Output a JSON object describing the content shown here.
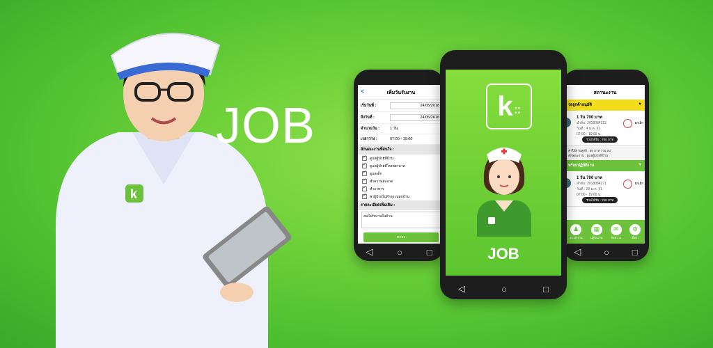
{
  "headline": "JOB",
  "center_app": {
    "title": "JOB",
    "logo_letter": "k"
  },
  "left_screen": {
    "title": "เพิ่มวันรับงาน",
    "rows": [
      {
        "label": "เริ่มวันที่ :",
        "value": "24/05/2018"
      },
      {
        "label": "ถึงวันที่ :",
        "value": "24/05/2018"
      },
      {
        "label": "จำนวนวัน :",
        "value": "1  วัน"
      },
      {
        "label": "เวลาว่าง :",
        "value": "07:00 - 19:00"
      }
    ],
    "section_label": "ลักษณะงานที่สนใจ :",
    "checks": [
      "ดูแลผู้ป่วยที่บ้าน",
      "ดูแลผู้ป่วยที่โรงพยาบาล",
      "ดูแลเด็ก",
      "ทำความสะอาด",
      "ทำอาหาร",
      "พาผู้ป่วยไปทำธุระนอกบ้าน"
    ],
    "details_label": "รายละเอียดเพิ่มเติม :",
    "note": "สนใจรับงานในบ้าน",
    "button": "ตกลง"
  },
  "right_screen": {
    "title": "สถานะงาน",
    "band1": "รอลูกค้าอนุมัติ",
    "band2": "พร้อมปฏิบัติงาน",
    "cards": [
      {
        "price": "1 วัน 700 บาท",
        "id": "ลำดับ: 2018084212",
        "date": "วันที่ : 4 ม.ค. 61",
        "time": "07:00 - 19:00 น.",
        "pill": "รวมได้รับ : 700 บาท",
        "cancel": "ยกเลิก"
      },
      {
        "price": "1 วัน 700 บาท",
        "id": "ลำดับ: 2018084271",
        "date": "วันที่ : 29 ม.ค. 61",
        "time": "07:00 - 19:00 น.",
        "pill": "รวมได้รับ : 700 บาท",
        "cancel": "ยกเลิก"
      }
    ],
    "info": [
      "ค่าใช้จ่ายสุทธิ : 86 บาท 778 ลบ",
      "ลักษณะงาน : ดูแลผู้ป่วยที่บ้าน"
    ],
    "tabs": [
      "สถานะงาน",
      "ปฏิทินงาน",
      "ข้อความ",
      "ตั้งค่า"
    ]
  },
  "phone_nav": [
    "◁",
    "○",
    "□"
  ],
  "colors": {
    "brand_green": "#6cc23a",
    "yellow": "#f2dc1c",
    "background": "#5cc52f"
  }
}
